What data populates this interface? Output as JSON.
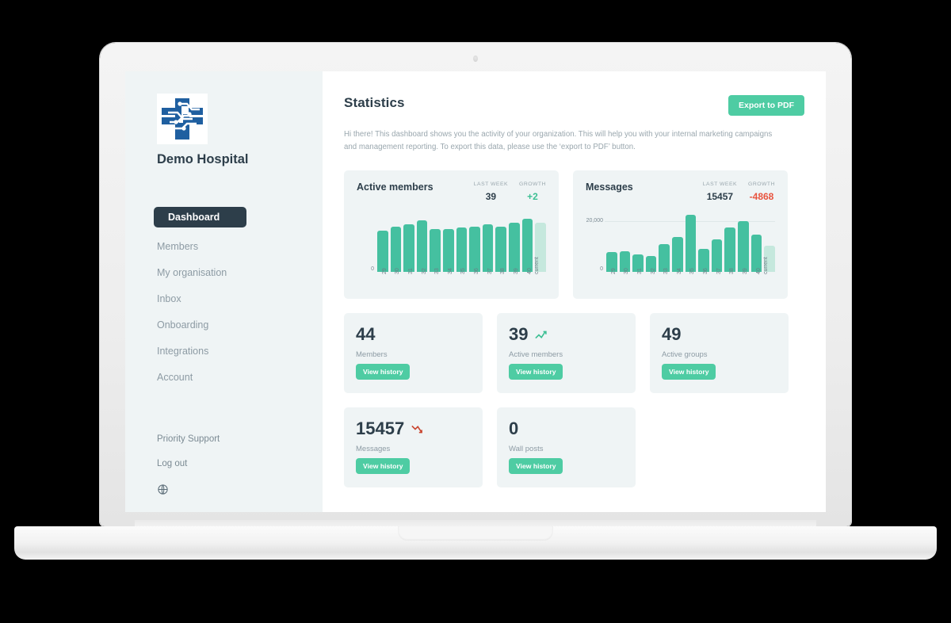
{
  "brand": {
    "name": "Demo Hospital",
    "logo_icon": "medical-circuit-cross-logo",
    "logo_color": "#1f5fa0"
  },
  "sidebar": {
    "items": [
      {
        "label": "Dashboard",
        "active": true
      },
      {
        "label": "Members",
        "active": false
      },
      {
        "label": "My organisation",
        "active": false
      },
      {
        "label": "Inbox",
        "active": false
      },
      {
        "label": "Onboarding",
        "active": false
      },
      {
        "label": "Integrations",
        "active": false
      },
      {
        "label": "Account",
        "active": false
      }
    ],
    "priority_support": "Priority Support",
    "log_out": "Log out",
    "language_icon": "globe-icon"
  },
  "header": {
    "title": "Statistics",
    "export_button": "Export to PDF",
    "intro": "Hi there! This dashboard shows you the activity of your organization. This will help you with your internal marketing campaigns and management reporting. To export this data, please use the ‘export to PDF’ button."
  },
  "kpi_labels": {
    "last_week": "LAST WEEK",
    "growth": "GROWTH"
  },
  "chart_data": [
    {
      "type": "bar",
      "title": "Active members",
      "last_week": "39",
      "growth": "+2",
      "growth_direction": "up",
      "categories": [
        "29",
        "30",
        "31",
        "32",
        "33",
        "34",
        "35",
        "36",
        "37",
        "38",
        "39",
        "40",
        "current"
      ],
      "values": [
        33,
        36,
        38,
        41,
        34,
        34,
        35,
        36,
        38,
        36,
        39,
        42,
        39
      ],
      "current_index": 12,
      "ylabel": "",
      "xlabel": "",
      "ylim": [
        0,
        50
      ],
      "yticks": [
        "0"
      ],
      "grid": false,
      "bar_color": "#45c0a0",
      "current_bar_color": "#c5e8dd"
    },
    {
      "type": "bar",
      "title": "Messages",
      "last_week": "15457",
      "growth": "-4868",
      "growth_direction": "down",
      "categories": [
        "29",
        "30",
        "31",
        "32",
        "33",
        "34",
        "35",
        "36",
        "37",
        "38",
        "39",
        "40",
        "current"
      ],
      "values": [
        7800,
        8300,
        7100,
        6300,
        11200,
        13800,
        22500,
        9200,
        13100,
        17600,
        20200,
        14900,
        10600
      ],
      "current_index": 12,
      "ylabel": "",
      "xlabel": "",
      "ylim": [
        0,
        25000
      ],
      "yticks": [
        "20,000",
        "0"
      ],
      "gridline_value": 20000,
      "grid": true,
      "bar_color": "#45c0a0",
      "current_bar_color": "#c5e8dd"
    }
  ],
  "stats": [
    {
      "value": "44",
      "label": "Members",
      "trend": "none",
      "button": "View history"
    },
    {
      "value": "39",
      "label": "Active members",
      "trend": "up",
      "button": "View history"
    },
    {
      "value": "49",
      "label": "Active groups",
      "trend": "none",
      "button": "View history"
    },
    {
      "value": "15457",
      "label": "Messages",
      "trend": "down",
      "button": "View history"
    },
    {
      "value": "0",
      "label": "Wall posts",
      "trend": "none",
      "button": "View history"
    }
  ],
  "colors": {
    "accent": "#4ecca3",
    "dark": "#2d3e4a",
    "up": "#3cbf93",
    "down": "#e8543f",
    "panel": "#eff4f5"
  }
}
